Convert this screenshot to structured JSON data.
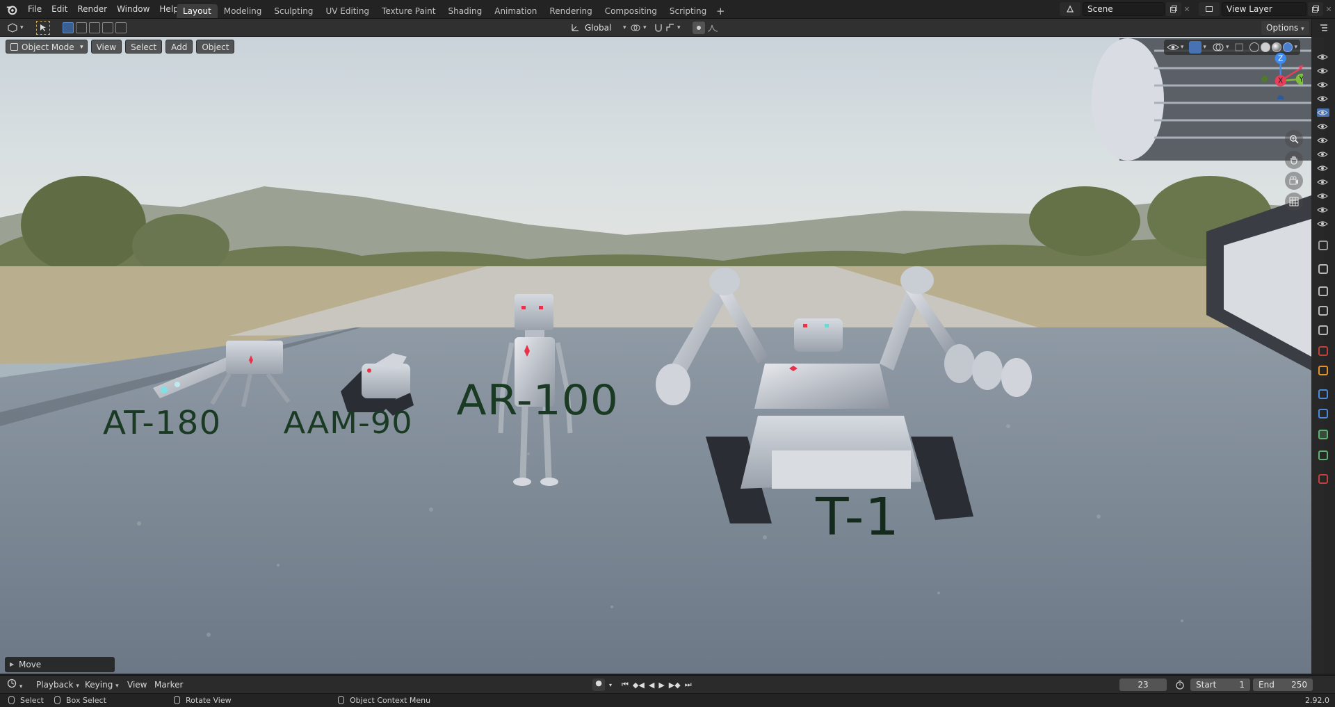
{
  "menus": [
    "File",
    "Edit",
    "Render",
    "Window",
    "Help"
  ],
  "workspaces": [
    {
      "label": "Layout",
      "active": true
    },
    {
      "label": "Modeling",
      "active": false
    },
    {
      "label": "Sculpting",
      "active": false
    },
    {
      "label": "UV Editing",
      "active": false
    },
    {
      "label": "Texture Paint",
      "active": false
    },
    {
      "label": "Shading",
      "active": false
    },
    {
      "label": "Animation",
      "active": false
    },
    {
      "label": "Rendering",
      "active": false
    },
    {
      "label": "Compositing",
      "active": false
    },
    {
      "label": "Scripting",
      "active": false
    }
  ],
  "scene": {
    "name": "Scene",
    "view_layer": "View Layer"
  },
  "header": {
    "mode": "Object Mode",
    "view": "View",
    "select": "Select",
    "add": "Add",
    "object": "Object",
    "transform_orientation": "Global",
    "options": "Options"
  },
  "viewport": {
    "labels": [
      "AT-180",
      "AAM-90",
      "AR-100",
      "T-1"
    ],
    "gizmo": {
      "z": "Z",
      "y": "Y",
      "x": "X"
    },
    "operator_panel": "Move"
  },
  "timeline": {
    "playback": "Playback",
    "keying": "Keying",
    "view": "View",
    "marker": "Marker",
    "current_frame": "23",
    "start_label": "Start",
    "start": "1",
    "end_label": "End",
    "end": "250"
  },
  "statusbar": {
    "select": "Select",
    "box_select": "Box Select",
    "rotate_view": "Rotate View",
    "context_menu": "Object Context Menu",
    "version": "2.92.0"
  },
  "colors": {
    "accent": "#4772b3",
    "label_green": "#1a3a24",
    "eye_red": "#e8324a",
    "axis_x": "#e8405a",
    "axis_y": "#7fbf3a",
    "axis_z": "#3f8cf0"
  }
}
